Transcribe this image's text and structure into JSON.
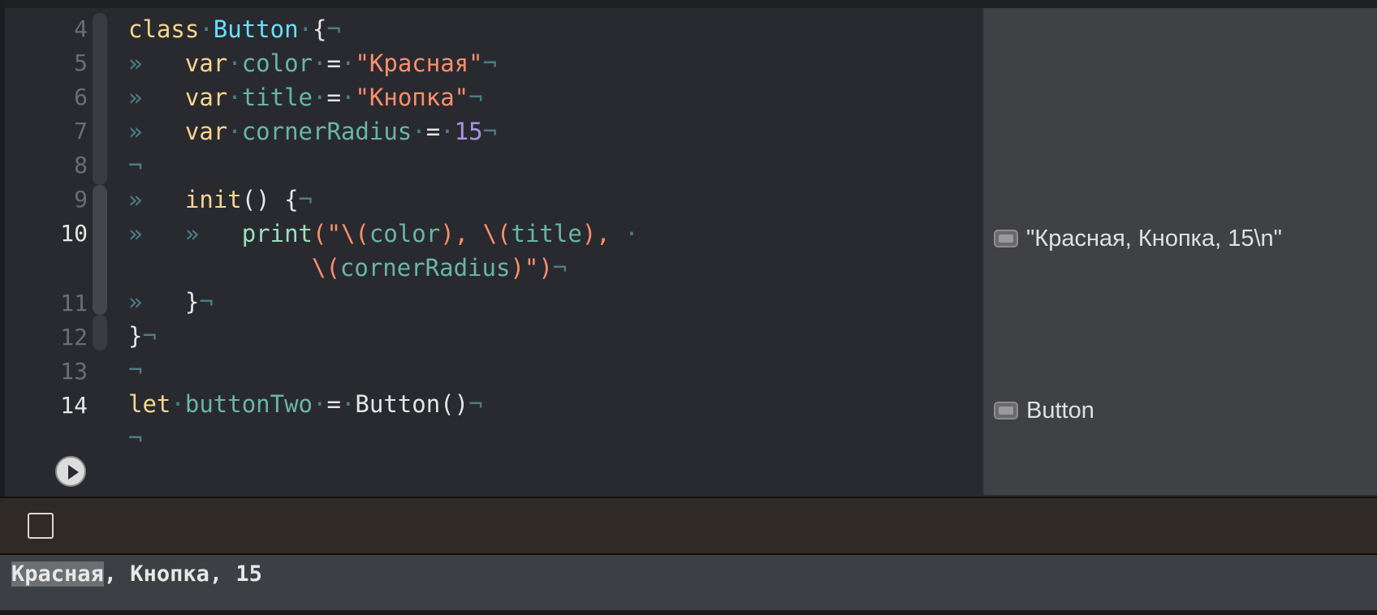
{
  "gutter": {
    "line_numbers": [
      "4",
      "5",
      "6",
      "7",
      "8",
      "9",
      "10",
      "11",
      "12",
      "13",
      "14"
    ],
    "current_lines": [
      "10",
      "14"
    ]
  },
  "code": {
    "l4": {
      "kw": "class",
      "type": "Button",
      "brace": "{"
    },
    "l5": {
      "kw": "var",
      "name": "color",
      "eq": "=",
      "value": "\"Красная\""
    },
    "l6": {
      "kw": "var",
      "name": "title",
      "eq": "=",
      "value": "\"Кнопка\""
    },
    "l7": {
      "kw": "var",
      "name": "cornerRadius",
      "eq": "=",
      "value": "15"
    },
    "l9": {
      "kw": "init",
      "rest": "() {"
    },
    "l10": {
      "fn": "print",
      "open": "(\"\\(",
      "a": "color",
      "sep1": "), \\(",
      "b": "title",
      "sep2": "), "
    },
    "l10b": {
      "pre": "\\(",
      "c": "cornerRadius",
      "close": ")\")"
    },
    "l11": {
      "brace": "}"
    },
    "l12": {
      "brace": "}"
    },
    "l14": {
      "kw": "let",
      "name": "buttonTwo",
      "eq": "=",
      "call": "Button()"
    }
  },
  "invisibles": {
    "tab": "»",
    "space": "·",
    "eol": "¬"
  },
  "results_sidebar": {
    "print_result": "\"Красная, Кнопка, 15\\n\"",
    "instance_result": "Button"
  },
  "console": {
    "selected": "Красная",
    "rest": ", Кнопка, 15"
  },
  "colors": {
    "editor_bg": "#292a30",
    "keyword": "#f8d58c",
    "type": "#6bdfff",
    "variable": "#67b7a4",
    "string": "#fc8f6b",
    "number": "#a993e0",
    "function": "#9ae0b8",
    "invisible": "#4c7d85"
  }
}
